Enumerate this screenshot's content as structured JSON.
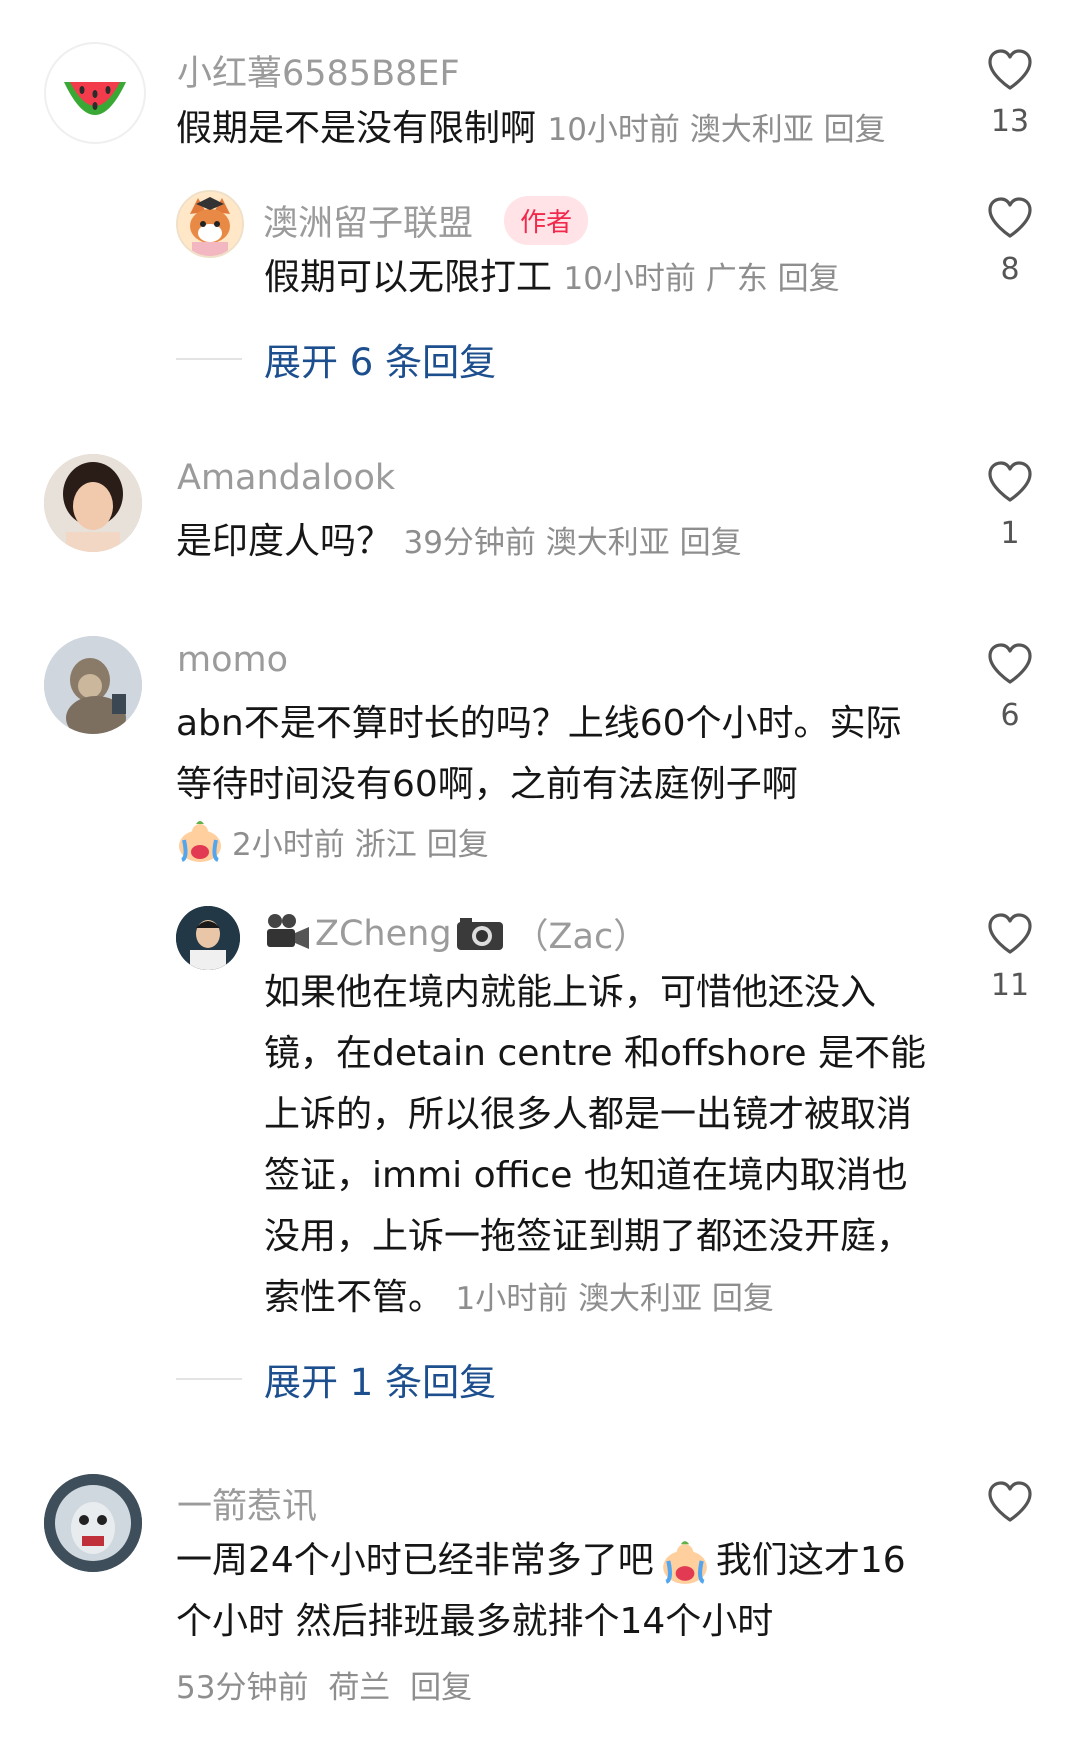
{
  "comments": [
    {
      "username": "小红薯6585B8EF",
      "text": "假期是不是没有限制啊",
      "time": "10小时前",
      "location": "澳大利亚",
      "reply_label": "回复",
      "likes": "13",
      "avatar_icon": "watermelon-icon"
    },
    {
      "username": "澳洲留子联盟",
      "badge": "作者",
      "text": "假期可以无限打工",
      "time": "10小时前",
      "location": "广东",
      "reply_label": "回复",
      "likes": "8"
    },
    {
      "username": "Amandalook",
      "text": "是印度人吗？",
      "time": "39分钟前",
      "location": "澳大利亚",
      "reply_label": "回复",
      "likes": "1"
    },
    {
      "username": "momo",
      "text": "abn不是不算时长的吗？上线60个小时。实际等待时间没有60啊，之前有法庭例子啊",
      "time": "2小时前",
      "location": "浙江",
      "reply_label": "回复",
      "likes": "6"
    },
    {
      "username": "ZCheng",
      "username_suffix": "（Zac）",
      "text": "如果他在境内就能上诉，可惜他还没入镜，在detain centre 和offshore 是不能上诉的，所以很多人都是一出镜才被取消签证，immi office 也知道在境内取消也没用，上诉一拖签证到期了都还没开庭，索性不管。",
      "time": "1小时前",
      "location": "澳大利亚",
      "reply_label": "回复",
      "likes": "11"
    },
    {
      "username": "一箭惹讯",
      "text": "一周24个小时已经非常多了吧",
      "text_after": "我们这才16个小时 然后排班最多就排个14个小时",
      "time": "53分钟前",
      "location": "荷兰",
      "reply_label": "回复"
    }
  ],
  "expand_replies": [
    {
      "label": "展开 6 条回复"
    },
    {
      "label": "展开 1 条回复"
    }
  ],
  "colors": {
    "username": "#9b9b9b",
    "text": "#161616",
    "meta": "#8e8e8e",
    "expand_link": "#1d4f8f",
    "author_badge_bg": "#ffe3e6",
    "author_badge_text": "#f1294c"
  }
}
